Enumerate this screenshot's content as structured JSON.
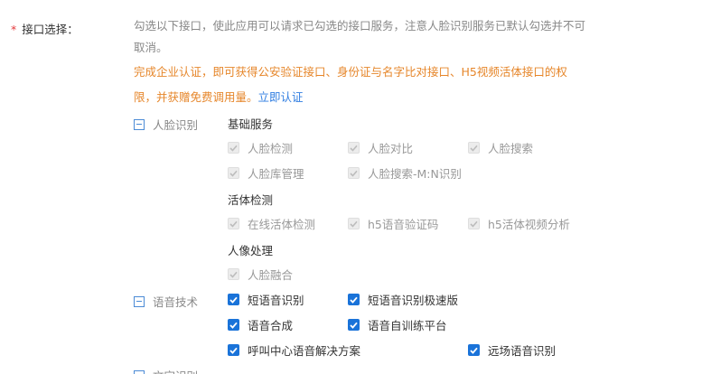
{
  "field": {
    "required_mark": "*",
    "label": "接口选择："
  },
  "description": "勾选以下接口，使此应用可以请求已勾选的接口服务，注意人脸识别服务已默认勾选并不可取消。",
  "notice": {
    "text": "完成企业认证，即可获得公安验证接口、身份证与名字比对接口、H5视频活体接口的权限，并获赠免费调用量。",
    "link": "立即认证"
  },
  "groups": {
    "face": {
      "label": "人脸识别",
      "sections": {
        "basic": {
          "title": "基础服务",
          "items": [
            "人脸检测",
            "人脸对比",
            "人脸搜索",
            "人脸库管理",
            "人脸搜索-M:N识别"
          ]
        },
        "liveness": {
          "title": "活体检测",
          "items": [
            "在线活体检测",
            "h5语音验证码",
            "h5活体视频分析"
          ]
        },
        "portrait": {
          "title": "人像处理",
          "items": [
            "人脸融合"
          ]
        }
      }
    },
    "speech": {
      "label": "语音技术",
      "items": [
        "短语音识别",
        "短语音识别极速版",
        "语音合成",
        "语音自训练平台",
        "呼叫中心语音解决方案",
        "远场语音识别"
      ]
    },
    "text": {
      "label": "文字识别"
    }
  },
  "colors": {
    "accent": "#1a73d9",
    "notice": "#e6862a",
    "link": "#2f7de1",
    "required": "#e4393c"
  }
}
